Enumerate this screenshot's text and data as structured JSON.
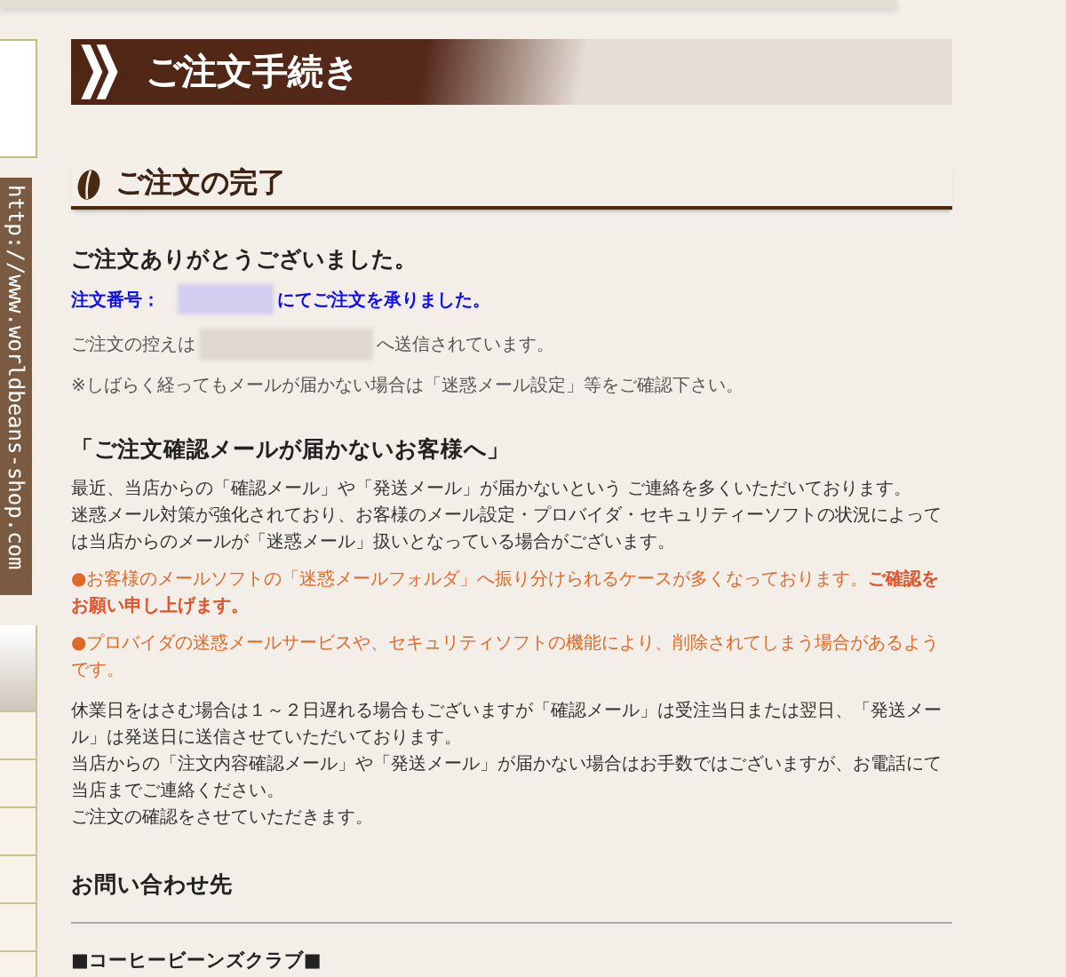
{
  "side_url": "http://www.worldbeans-shop.com",
  "page_title": "ご注文手続き",
  "section_title": "ご注文の完了",
  "thanks": "ご注文ありがとうございました。",
  "order_label": "注文番号：",
  "order_suffix": "にてご注文を承りました。",
  "copy_prefix": "ご注文の控えは",
  "copy_suffix": "へ送信されています。",
  "notice": "※しばらく経ってもメールが届かない場合は「迷惑メール設定」等をご確認下さい。",
  "mail_heading": "「ご注文確認メールが届かないお客様へ」",
  "intro_lines": [
    "最近、当店からの「確認メール」や「発送メール」が届かないという ご連絡を多くいただいております。",
    "迷惑メール対策が強化されており、お客様のメール設定・プロバイダ・セキュリティーソフトの状況によっては当店からのメールが「迷惑メール」扱いとなっている場合がございます。"
  ],
  "bullets": [
    "●お客様のメールソフトの「迷惑メールフォルダ」へ振り分けられるケースが多くなっております。**ご確認をお願い申し上げます。**",
    "●プロバイダの迷惑メールサービスや、セキュリティソフトの機能により、削除されてしまう場合があるようです。"
  ],
  "closing_lines": [
    "休業日をはさむ場合は１～２日遅れる場合もございますが「確認メール」は受注当日または翌日、「発送メール」は発送日に送信させていただいております。",
    "当店からの「注文内容確認メール」や「発送メール」が届かない場合はお手数ではございますが、お電話にて当店までご連絡ください。",
    "ご注文の確認をさせていただきます。"
  ],
  "contact_heading": "お問い合わせ先",
  "shop_name": "■コーヒービーンズクラブ■"
}
